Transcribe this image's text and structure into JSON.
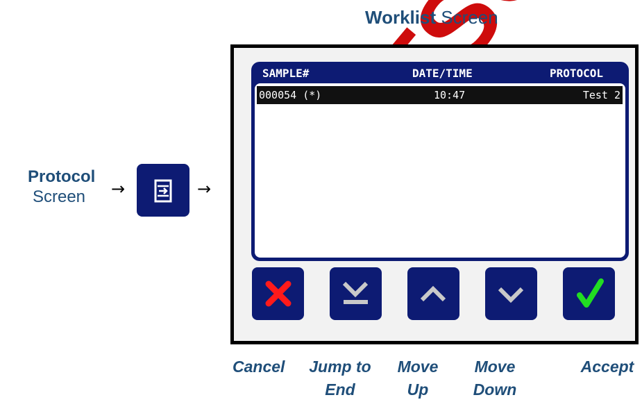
{
  "header": {
    "title_bold": "Worklist",
    "title_rest": " Screen"
  },
  "protocol": {
    "label_bold": "Protocol",
    "label_rest": "Screen",
    "button_icon": "enter-arrow-icon"
  },
  "arrow_glyph": "→",
  "list": {
    "columns": {
      "sample": "SAMPLE#",
      "datetime": "DATE/TIME",
      "protocol": "PROTOCOL"
    },
    "rows": [
      {
        "sample": "000054 (*)",
        "time": "10:47",
        "protocol": "Test 2",
        "selected": true
      }
    ]
  },
  "buttons": [
    {
      "name": "cancel",
      "icon": "x-icon",
      "color": "#ff1a1a"
    },
    {
      "name": "jump-to-end",
      "icon": "jump-to-end-icon",
      "color": "#c9c9c9"
    },
    {
      "name": "move-up",
      "icon": "chevron-up-icon",
      "color": "#c9c9c9"
    },
    {
      "name": "move-down",
      "icon": "chevron-down-icon",
      "color": "#c9c9c9"
    },
    {
      "name": "accept",
      "icon": "check-icon",
      "color": "#22dd22"
    }
  ],
  "button_labels": {
    "cancel": "Cancel",
    "jump_line1": "Jump to",
    "jump_line2": "End",
    "move_up_line1": "Move",
    "move_up_line2": "Up",
    "move_down_line1": "Move",
    "move_down_line2": "Down",
    "accept": "Accept"
  },
  "watermark": "DUTSCHER",
  "colors": {
    "panel": "#0d1b73",
    "caption": "#1f4e79",
    "watermark": "#cc0000"
  }
}
